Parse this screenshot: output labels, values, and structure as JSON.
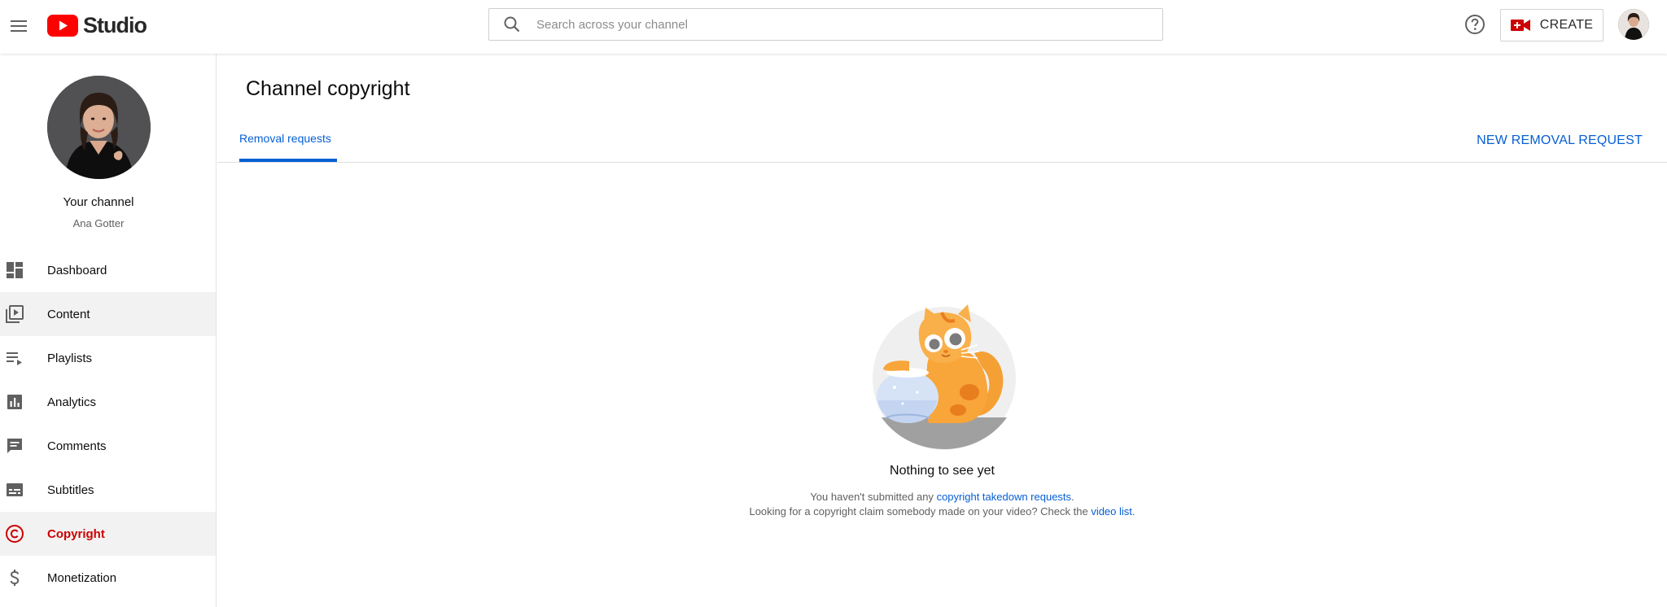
{
  "header": {
    "logo_text": "Studio",
    "search_placeholder": "Search across your channel",
    "create_label": "CREATE"
  },
  "sidebar": {
    "your_channel": "Your channel",
    "channel_name": "Ana Gotter",
    "items": [
      {
        "label": "Dashboard",
        "icon": "dashboard-icon"
      },
      {
        "label": "Content",
        "icon": "content-icon"
      },
      {
        "label": "Playlists",
        "icon": "playlists-icon"
      },
      {
        "label": "Analytics",
        "icon": "analytics-icon"
      },
      {
        "label": "Comments",
        "icon": "comments-icon"
      },
      {
        "label": "Subtitles",
        "icon": "subtitles-icon"
      },
      {
        "label": "Copyright",
        "icon": "copyright-icon"
      },
      {
        "label": "Monetization",
        "icon": "dollar-icon"
      }
    ],
    "active_color": "#cc0000"
  },
  "main": {
    "title": "Channel copyright",
    "tabs": [
      {
        "label": "Removal requests"
      }
    ],
    "new_request_label": "NEW REMOVAL REQUEST",
    "empty": {
      "title": "Nothing to see yet",
      "line1_prefix": "You haven't submitted any ",
      "line1_link": "copyright takedown requests",
      "line1_suffix": ".",
      "line2_prefix": "Looking for a copyright claim somebody made on your video? Check the ",
      "line2_link": "video list",
      "line2_suffix": "."
    }
  },
  "colors": {
    "link": "#065fd4",
    "brand_red": "#ff0000"
  }
}
